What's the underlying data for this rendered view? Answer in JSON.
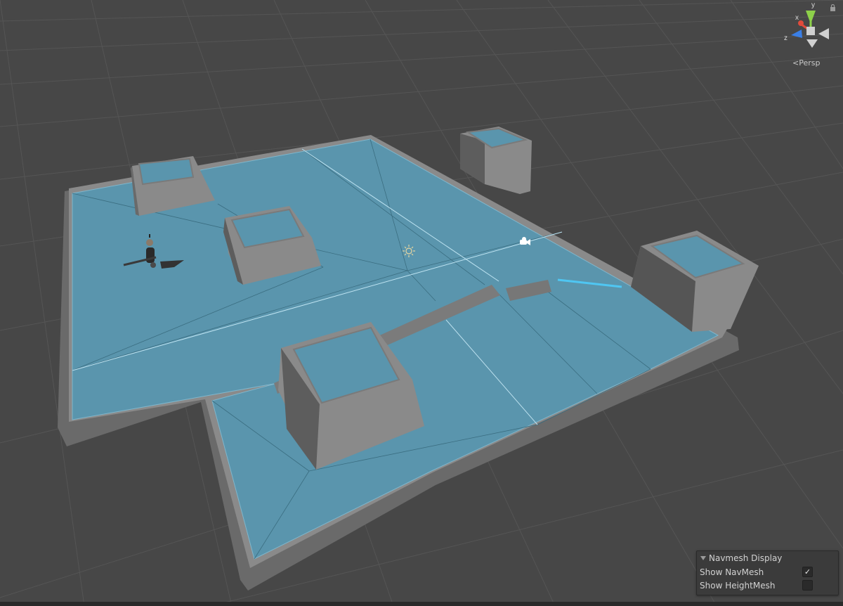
{
  "viewport": {
    "projection_label": "<Persp",
    "gizmo": {
      "axis_x": "x",
      "axis_y": "y",
      "axis_z": "z",
      "colors": {
        "x": "#e14b3b",
        "y": "#8dd04a",
        "z": "#3a7fe6"
      }
    },
    "lock_icon": "lock-icon",
    "navmesh_color": "#5a95ad",
    "geometry_color": "#8a8a8a"
  },
  "overlay": {
    "title": "Navmesh Display",
    "rows": [
      {
        "label": "Show NavMesh",
        "checked": true,
        "check_glyph": "✓"
      },
      {
        "label": "Show HeightMesh",
        "checked": false,
        "check_glyph": ""
      }
    ]
  }
}
